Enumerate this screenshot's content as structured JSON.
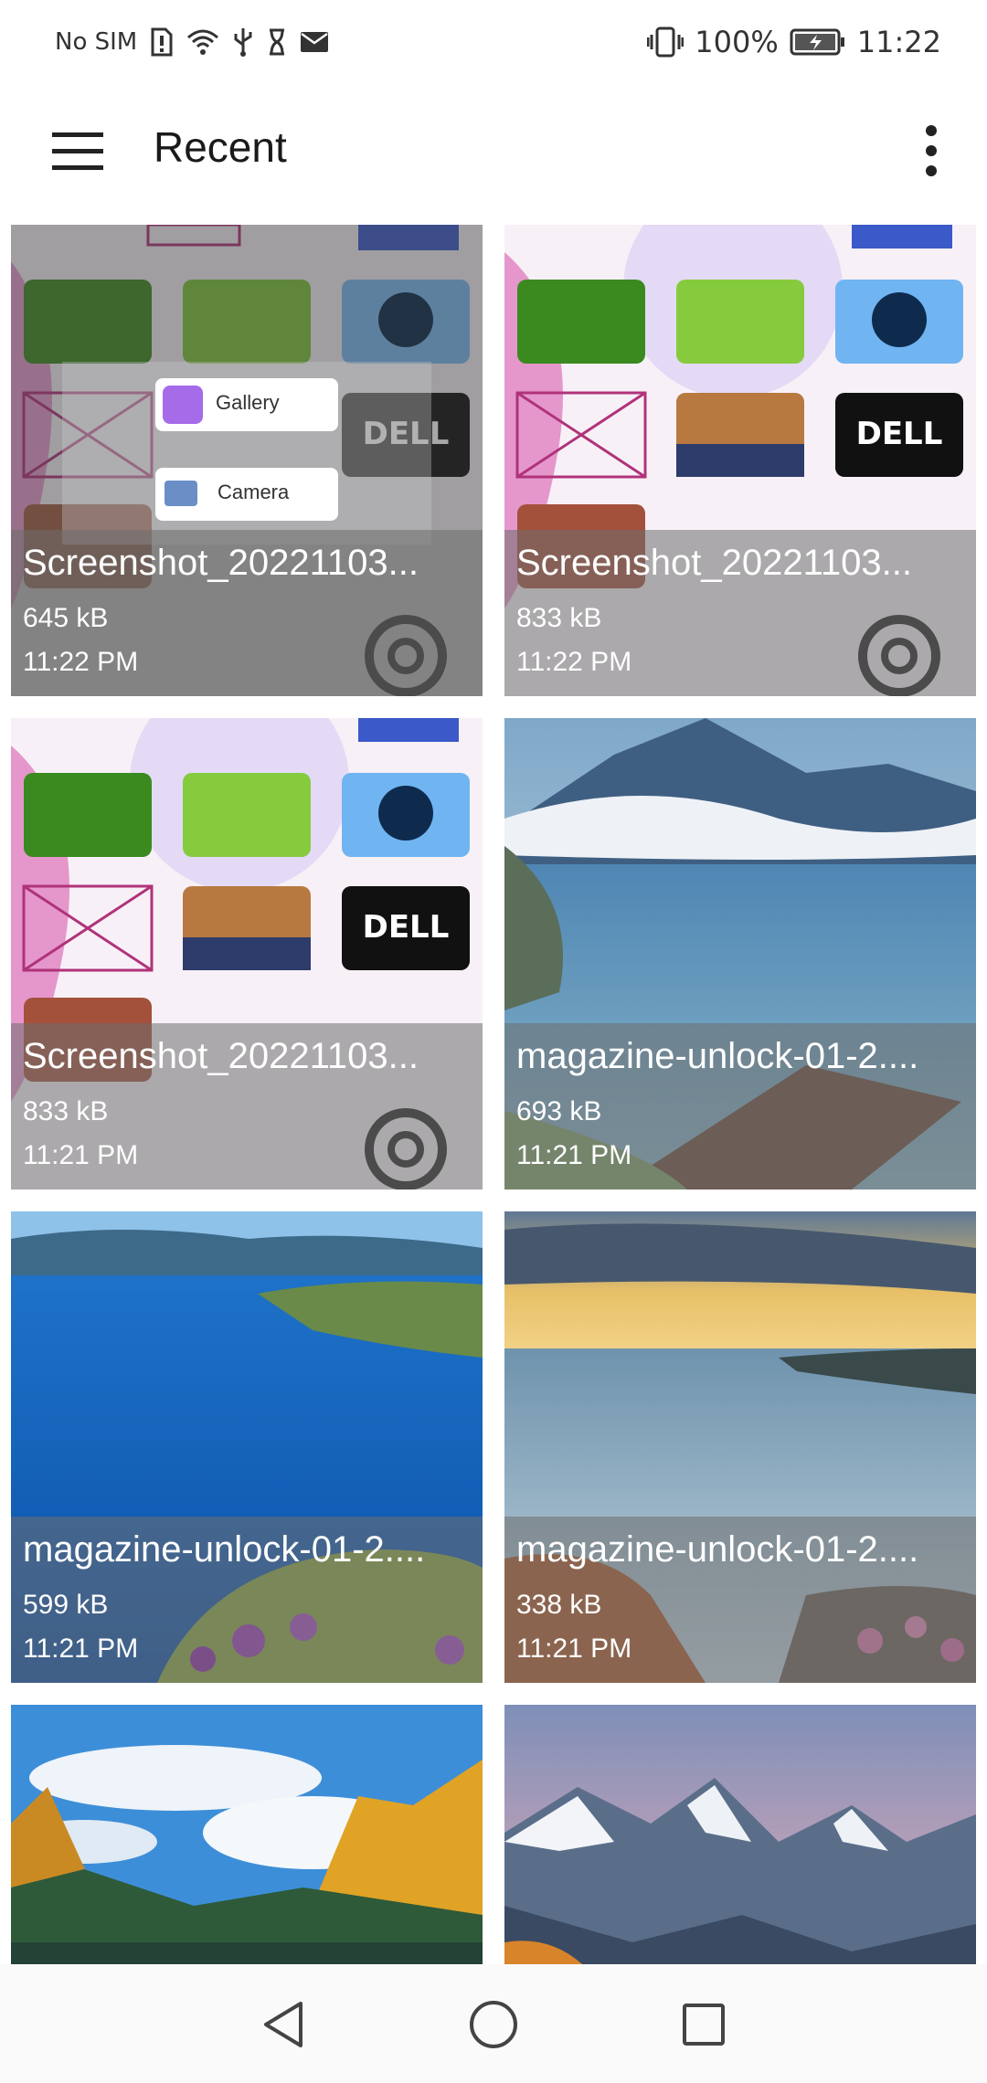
{
  "status_bar": {
    "carrier": "No SIM",
    "battery": "100%",
    "time": "11:22",
    "icons": [
      "sim-alert-icon",
      "wifi-icon",
      "usb-icon",
      "hourglass-icon",
      "mail-icon",
      "vibrate-icon",
      "battery-charging-icon"
    ]
  },
  "app_bar": {
    "title": "Recent",
    "menu_icon": "hamburger-menu-icon",
    "more_icon": "more-vert-icon"
  },
  "files": [
    {
      "name": "Screenshot_20221103...",
      "size": "645 kB",
      "time": "11:22 PM",
      "kind": "screenshot-with-dialog"
    },
    {
      "name": "Screenshot_20221103...",
      "size": "833 kB",
      "time": "11:22 PM",
      "kind": "screenshot"
    },
    {
      "name": "Screenshot_20221103...",
      "size": "833 kB",
      "time": "11:21 PM",
      "kind": "screenshot"
    },
    {
      "name": "magazine-unlock-01-2....",
      "size": "693 kB",
      "time": "11:21 PM",
      "kind": "lake"
    },
    {
      "name": "magazine-unlock-01-2....",
      "size": "599 kB",
      "time": "11:21 PM",
      "kind": "coast"
    },
    {
      "name": "magazine-unlock-01-2....",
      "size": "338 kB",
      "time": "11:21 PM",
      "kind": "sunset-sea"
    },
    {
      "name": "",
      "size": "",
      "time": "",
      "kind": "autumn-forest"
    },
    {
      "name": "",
      "size": "",
      "time": "",
      "kind": "mountains"
    }
  ],
  "dialog": {
    "gallery_label": "Gallery",
    "camera_label": "Camera"
  },
  "nav_bar": {
    "back_icon": "back-triangle-icon",
    "home_icon": "home-circle-icon",
    "recents_icon": "recents-square-icon"
  }
}
